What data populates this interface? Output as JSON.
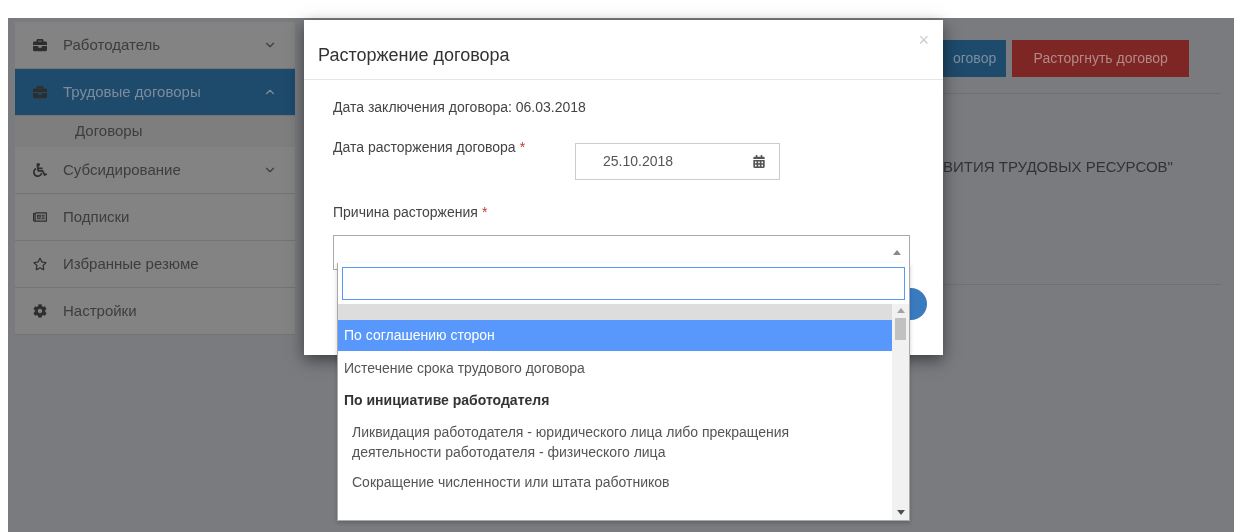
{
  "sidebar": {
    "items": [
      {
        "label": "Работодатель",
        "selected": false,
        "expanded": false
      },
      {
        "label": "Трудовые договоры",
        "selected": true,
        "expanded": true,
        "children": [
          {
            "label": "Договоры"
          }
        ]
      },
      {
        "label": "Субсидирование",
        "selected": false,
        "expanded": false
      },
      {
        "label": "Подписки",
        "selected": false
      },
      {
        "label": "Избранные резюме",
        "selected": false
      },
      {
        "label": "Настройки",
        "selected": false
      }
    ]
  },
  "page_actions": [
    {
      "kind": "primary",
      "label": "оговор"
    },
    {
      "kind": "danger",
      "label": "Расторгнуть договор"
    }
  ],
  "organization_name": "ВИТИЯ ТРУДОВЫХ РЕСУРСОВ\"",
  "modal": {
    "title": "Расторжение договора",
    "close": "×",
    "conclusion_date": "Дата заключения договора: 06.03.2018",
    "end_date": {
      "label": "Дата расторжения договора",
      "required_mark": "*",
      "value": "25.10.2018"
    },
    "reason": {
      "label": "Причина расторжения",
      "required_mark": "*",
      "expanded": true
    }
  },
  "dropdown": {
    "options": [
      {
        "kind": "option",
        "label": "По соглашению сторон",
        "selected": true
      },
      {
        "kind": "option",
        "label": "Истечение срока трудового договора",
        "selected": false
      },
      {
        "kind": "group",
        "label": "По инициативе работодателя",
        "children": [
          {
            "label": "Ликвидация работодателя - юридического лица либо прекращения деятельности работодателя - физического лица",
            "selected": false
          },
          {
            "label": "Сокращение численности или штата работников",
            "selected": false
          }
        ]
      }
    ]
  }
}
